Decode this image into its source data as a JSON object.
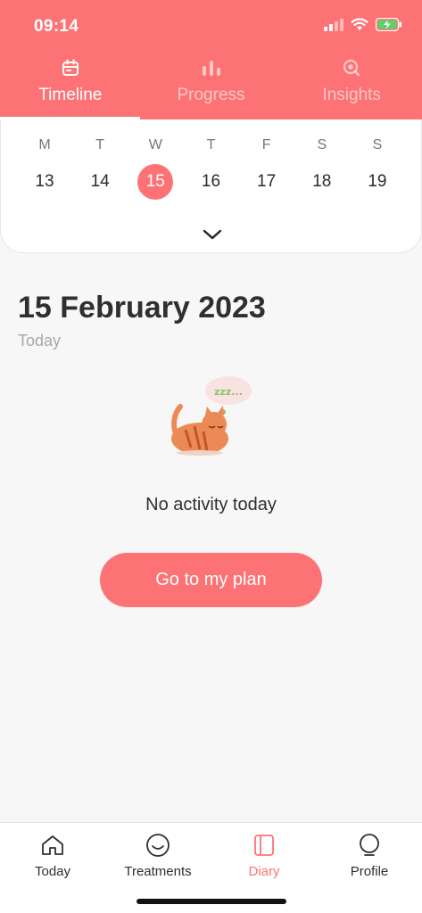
{
  "status_bar": {
    "time": "09:14",
    "icons": [
      "signal-icon",
      "wifi-icon",
      "battery-charging-icon"
    ]
  },
  "tabs": [
    {
      "label": "Timeline",
      "icon": "calendar-icon",
      "active": true
    },
    {
      "label": "Progress",
      "icon": "bar-chart-icon",
      "active": false
    },
    {
      "label": "Insights",
      "icon": "insights-icon",
      "active": false
    }
  ],
  "week": {
    "days": [
      {
        "letter": "M",
        "number": "13",
        "selected": false
      },
      {
        "letter": "T",
        "number": "14",
        "selected": false
      },
      {
        "letter": "W",
        "number": "15",
        "selected": true
      },
      {
        "letter": "T",
        "number": "16",
        "selected": false
      },
      {
        "letter": "F",
        "number": "17",
        "selected": false
      },
      {
        "letter": "S",
        "number": "18",
        "selected": false
      },
      {
        "letter": "S",
        "number": "19",
        "selected": false
      }
    ],
    "expand_icon": "chevron-down-icon"
  },
  "diary": {
    "date_title": "15 February 2023",
    "date_subtitle": "Today",
    "illustration_text": "zzz...",
    "empty_message": "No activity today",
    "plan_button": "Go to my plan"
  },
  "bottom_nav": [
    {
      "label": "Today",
      "icon": "home-icon",
      "active": false
    },
    {
      "label": "Treatments",
      "icon": "smiley-icon",
      "active": false
    },
    {
      "label": "Diary",
      "icon": "diary-icon",
      "active": true
    },
    {
      "label": "Profile",
      "icon": "profile-icon",
      "active": false
    }
  ],
  "colors": {
    "accent": "#fd7375",
    "background": "#f7f7f7",
    "text": "#2f2f2f",
    "muted": "#a8a8a8"
  }
}
